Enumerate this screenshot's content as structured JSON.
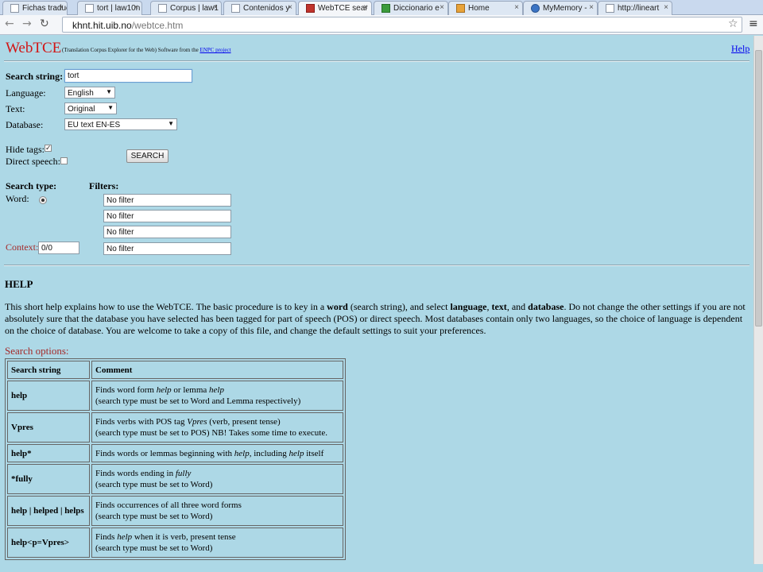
{
  "browser": {
    "tabs": [
      {
        "label": "Fichas traduc",
        "favicon": "page"
      },
      {
        "label": "tort | law10n",
        "favicon": "page"
      },
      {
        "label": "Corpus | law1",
        "favicon": "page"
      },
      {
        "label": "Contenidos y",
        "favicon": "page"
      },
      {
        "label": "WebTCE sear",
        "favicon": "red",
        "active": true
      },
      {
        "label": "Diccionario e",
        "favicon": "green"
      },
      {
        "label": "Home",
        "favicon": "orange"
      },
      {
        "label": "MyMemory -",
        "favicon": "globe"
      },
      {
        "label": "http://lineart",
        "favicon": "page"
      }
    ],
    "url_host": "khnt.hit.uib.no",
    "url_path": "/webtce.htm"
  },
  "header": {
    "logo": "WebTCE",
    "subtitle": "(Translation Corpus Explorer for the Web) Software from the",
    "subtitle_link": "ENPC project",
    "help_link": "Help"
  },
  "form": {
    "search_label": "Search string:",
    "search_value": "tort",
    "language_label": "Language:",
    "language_value": "English",
    "text_label": "Text:",
    "text_value": "Original",
    "database_label": "Database:",
    "database_value": "EU text EN-ES",
    "hide_tags_label": "Hide tags:",
    "hide_tags_checked": true,
    "direct_speech_label": "Direct speech:",
    "search_button": "SEARCH",
    "search_type_label": "Search type:",
    "filters_label": "Filters:",
    "word_label": "Word:",
    "filters": [
      "No filter",
      "No filter",
      "No filter",
      "No filter"
    ],
    "context_label": "Context:",
    "context_value": "0/0"
  },
  "help": {
    "heading": "HELP",
    "intro_1": "This short help explains how to use the WebTCE. The basic procedure is to key in a ",
    "intro_word": "word",
    "intro_2": " (search string), and select ",
    "intro_language": "language",
    "intro_3": ", ",
    "intro_text": "text",
    "intro_4": ", and ",
    "intro_database": "database",
    "intro_5": ". Do not change the other settings if you are not absolutely sure that the database you have selected has been tagged for part of speech (POS) or direct speech. Most databases contain only two languages, so the choice of language is dependent on the choice of database. You are welcome to take a copy of this file, and change the default settings to suit your preferences.",
    "search_options": "Search options:",
    "table": {
      "header_key": "Search string",
      "header_comment": "Comment",
      "rows": [
        {
          "key": "help",
          "l1a": "Finds word form ",
          "l1i": "help",
          "l1b": " or lemma ",
          "l1j": "help",
          "l2": "(search type must be set to Word and Lemma respectively)"
        },
        {
          "key": "Vpres",
          "l1a": "Finds verbs with POS tag ",
          "l1i": "Vpres",
          "l1b": " (verb, present tense)",
          "l1j": "",
          "l2": "(search type must be set to POS) NB! Takes some time to execute."
        },
        {
          "key": "help*",
          "l1a": "Finds words or lemmas beginning with ",
          "l1i": "help",
          "l1b": ", including ",
          "l1j": "help",
          "l1c": " itself",
          "l2": ""
        },
        {
          "key": "*fully",
          "l1a": "Finds words ending in ",
          "l1i": "fully",
          "l1b": "",
          "l1j": "",
          "l2": "(search type must be set to Word)"
        },
        {
          "key": "help | helped | helps",
          "l1a": "Finds occurrences of all three word forms",
          "l1i": "",
          "l1b": "",
          "l1j": "",
          "l2": "(search type must be set to Word)"
        },
        {
          "key": "help<p=Vpres>",
          "l1a": "Finds ",
          "l1i": "help",
          "l1b": " when it is verb, present tense",
          "l1j": "",
          "l2": "(search type must be set to Word)"
        }
      ]
    }
  }
}
